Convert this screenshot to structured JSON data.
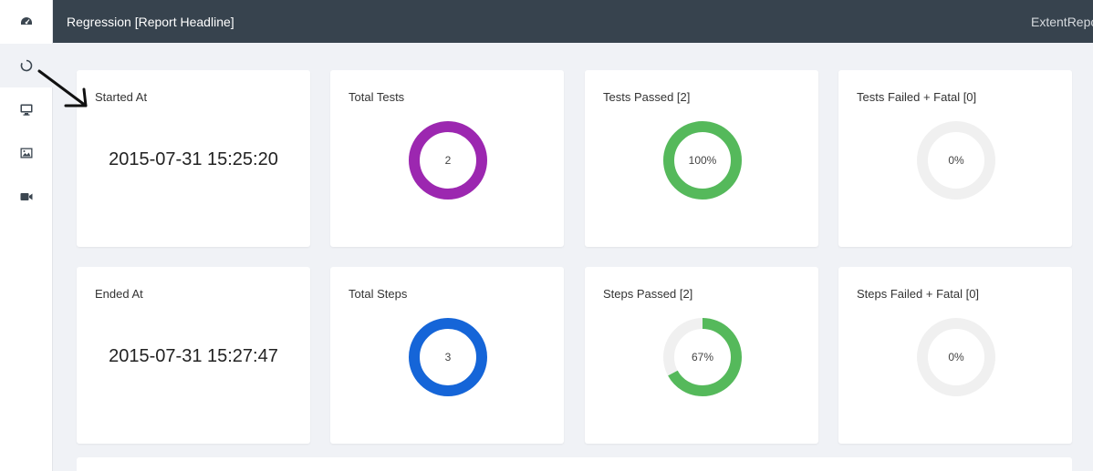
{
  "header": {
    "title": "Regression [Report Headline]",
    "brand": "ExtentReports"
  },
  "sidebar": {
    "items": [
      {
        "icon": "dashboard-icon",
        "active": false
      },
      {
        "icon": "circle-loading-icon",
        "active": true
      },
      {
        "icon": "desktop-icon",
        "active": false
      },
      {
        "icon": "image-icon",
        "active": false
      },
      {
        "icon": "video-camera-icon",
        "active": false
      }
    ]
  },
  "colors": {
    "purple": "#9c27b0",
    "blue": "#1565d8",
    "green": "#55b95b",
    "track": "#f0f0f0",
    "topbar": "#37434e"
  },
  "summary": {
    "started": {
      "label": "Started At",
      "value": "2015-07-31 15:25:20"
    },
    "ended": {
      "label": "Ended At",
      "value": "2015-07-31 15:27:47"
    },
    "total_tests": {
      "label": "Total Tests",
      "center": "2",
      "fraction": 1.0
    },
    "tests_passed": {
      "label": "Tests Passed [2]",
      "center": "100%",
      "fraction": 1.0
    },
    "tests_failed": {
      "label": "Tests Failed + Fatal [0]",
      "center": "0%",
      "fraction": 0.0
    },
    "total_steps": {
      "label": "Total Steps",
      "center": "3",
      "fraction": 1.0
    },
    "steps_passed": {
      "label": "Steps Passed [2]",
      "center": "67%",
      "fraction": 0.67
    },
    "steps_failed": {
      "label": "Steps Failed + Fatal [0]",
      "center": "0%",
      "fraction": 0.0
    }
  }
}
